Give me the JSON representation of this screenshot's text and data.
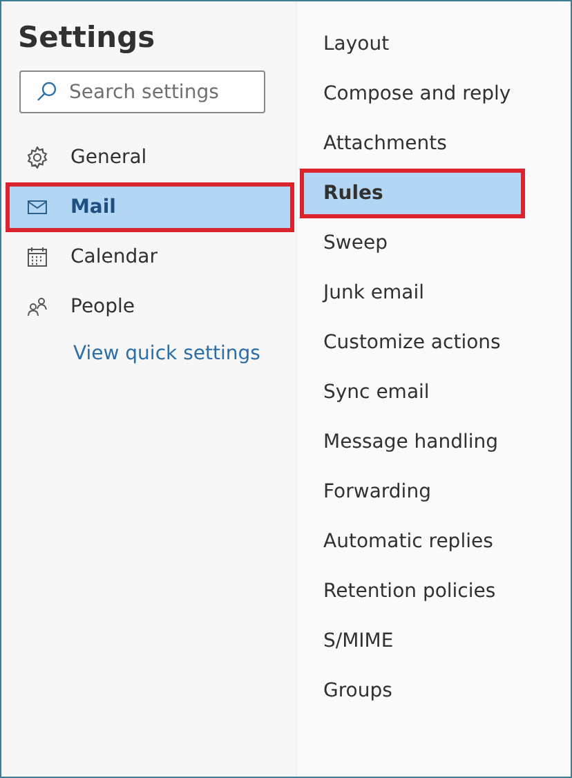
{
  "title": "Settings",
  "search": {
    "placeholder": "Search settings"
  },
  "categories": [
    {
      "label": "General",
      "kind": "gear",
      "selected": false,
      "highlighted": false
    },
    {
      "label": "Mail",
      "kind": "mail",
      "selected": true,
      "highlighted": true
    },
    {
      "label": "Calendar",
      "kind": "calendar",
      "selected": false,
      "highlighted": false
    },
    {
      "label": "People",
      "kind": "people",
      "selected": false,
      "highlighted": false
    }
  ],
  "quick_settings_link": "View quick settings",
  "mail_sections": [
    {
      "label": "Layout",
      "selected": false,
      "highlighted": false
    },
    {
      "label": "Compose and reply",
      "selected": false,
      "highlighted": false
    },
    {
      "label": "Attachments",
      "selected": false,
      "highlighted": false
    },
    {
      "label": "Rules",
      "selected": true,
      "highlighted": true
    },
    {
      "label": "Sweep",
      "selected": false,
      "highlighted": false
    },
    {
      "label": "Junk email",
      "selected": false,
      "highlighted": false
    },
    {
      "label": "Customize actions",
      "selected": false,
      "highlighted": false
    },
    {
      "label": "Sync email",
      "selected": false,
      "highlighted": false
    },
    {
      "label": "Message handling",
      "selected": false,
      "highlighted": false
    },
    {
      "label": "Forwarding",
      "selected": false,
      "highlighted": false
    },
    {
      "label": "Automatic replies",
      "selected": false,
      "highlighted": false
    },
    {
      "label": "Retention policies",
      "selected": false,
      "highlighted": false
    },
    {
      "label": "S/MIME",
      "selected": false,
      "highlighted": false
    },
    {
      "label": "Groups",
      "selected": false,
      "highlighted": false
    }
  ]
}
